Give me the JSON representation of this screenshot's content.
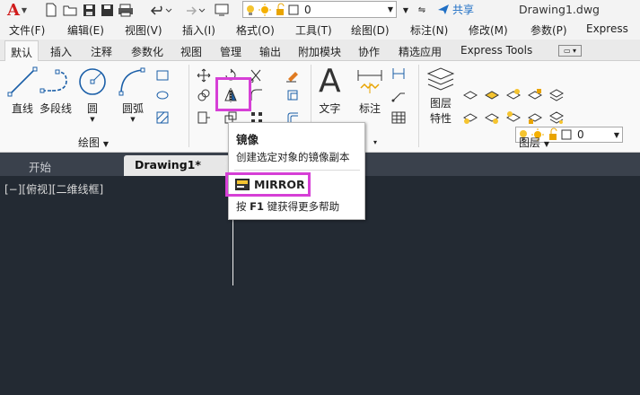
{
  "app": {
    "logo_letter": "A",
    "layer_value": "0",
    "share_label": "共享",
    "document_title": "Drawing1.dwg"
  },
  "menu": {
    "items": [
      "文件(F)",
      "编辑(E)",
      "视图(V)",
      "插入(I)",
      "格式(O)",
      "工具(T)",
      "绘图(D)",
      "标注(N)",
      "修改(M)",
      "参数(P)",
      "Express"
    ]
  },
  "ribbon_tabs": {
    "items": [
      "默认",
      "插入",
      "注释",
      "参数化",
      "视图",
      "管理",
      "输出",
      "附加模块",
      "协作",
      "精选应用",
      "Express Tools"
    ]
  },
  "ribbon": {
    "draw": {
      "line": "直线",
      "polyline": "多段线",
      "circle": "圆",
      "arc": "圆弧",
      "panel_title": "绘图"
    },
    "annotation": {
      "text": "文字",
      "dimension": "标注",
      "panel_title_caret": "▾"
    },
    "layers": {
      "properties_line1": "图层",
      "properties_line2": "特性",
      "layer_value": "0",
      "panel_title": "图层"
    }
  },
  "file_tabs": {
    "start": "开始",
    "drawing": "Drawing1*",
    "close": "×"
  },
  "viewport": {
    "label": "[−][俯视][二维线框]"
  },
  "tooltip": {
    "title": "镜像",
    "description": "创建选定对象的镜像副本",
    "command": "MIRROR",
    "help_prefix": "按 ",
    "help_key": "F1",
    "help_suffix": " 键获得更多帮助"
  },
  "colors": {
    "highlight": "#d63fd6",
    "canvas": "#232a33",
    "share": "#1f6fc5",
    "logo": "#d01c1c"
  }
}
